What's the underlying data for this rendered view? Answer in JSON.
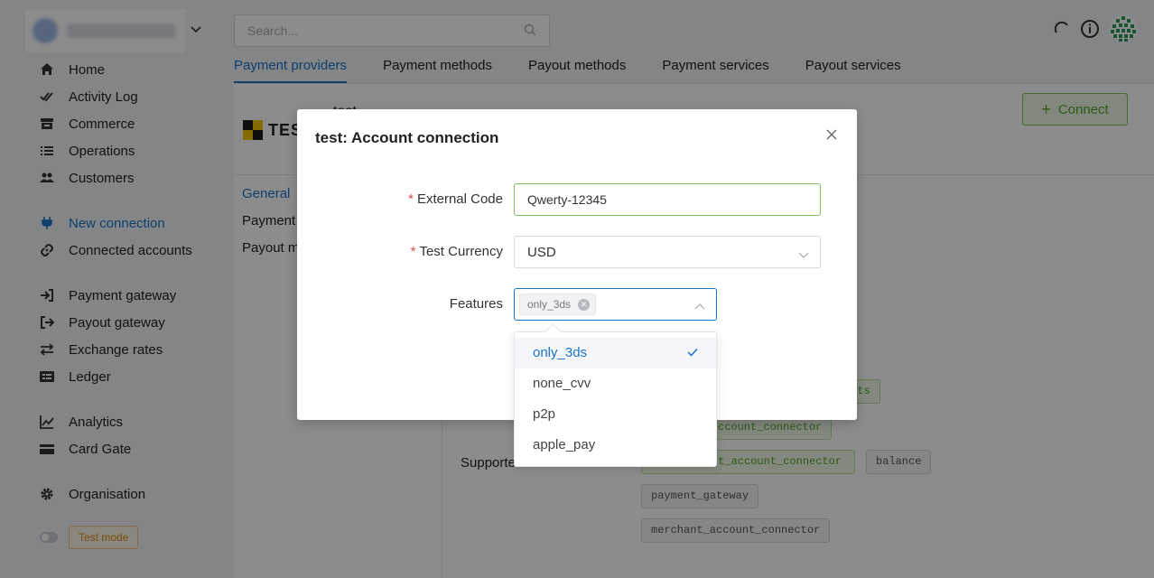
{
  "sidebar": {
    "nav": [
      {
        "label": "Home",
        "icon": "home-icon"
      },
      {
        "label": "Activity Log",
        "icon": "double-check-icon"
      },
      {
        "label": "Commerce",
        "icon": "store-icon"
      },
      {
        "label": "Operations",
        "icon": "list-icon"
      },
      {
        "label": "Customers",
        "icon": "users-icon"
      },
      {
        "label": "New connection",
        "icon": "plug-icon",
        "active": true
      },
      {
        "label": "Connected accounts",
        "icon": "link-icon"
      },
      {
        "label": "Payment gateway",
        "icon": "sign-in-icon"
      },
      {
        "label": "Payout gateway",
        "icon": "sign-out-icon"
      },
      {
        "label": "Exchange rates",
        "icon": "exchange-icon"
      },
      {
        "label": "Ledger",
        "icon": "ledger-icon"
      },
      {
        "label": "Analytics",
        "icon": "chart-icon"
      },
      {
        "label": "Card Gate",
        "icon": "card-icon"
      },
      {
        "label": "Organisation",
        "icon": "gear-icon"
      }
    ],
    "test_mode": "Test mode"
  },
  "search": {
    "placeholder": "Search..."
  },
  "tabs": [
    "Payment providers",
    "Payment methods",
    "Payout methods",
    "Payment services",
    "Payout services"
  ],
  "provider": {
    "brand": "TES",
    "name": "test",
    "connect_label": "Connect"
  },
  "side_menu": [
    "General",
    "Payment",
    "Payout m"
  ],
  "supported_label": "Supporte",
  "tags": [
    "ents",
    "ccount_connector",
    "nt_account_connector",
    "balance",
    "payment_gateway",
    "merchant_account_connector"
  ],
  "modal": {
    "title": "test: Account connection",
    "fields": {
      "external_code": {
        "label": "External Code",
        "value": "Qwerty-12345"
      },
      "test_currency": {
        "label": "Test Currency",
        "value": "USD"
      },
      "features": {
        "label": "Features",
        "chips": [
          "only_3ds"
        ]
      }
    }
  },
  "dropdown": {
    "options": [
      {
        "label": "only_3ds",
        "selected": true
      },
      {
        "label": "none_cvv",
        "selected": false
      },
      {
        "label": "p2p",
        "selected": false
      },
      {
        "label": "apple_pay",
        "selected": false
      }
    ]
  },
  "colors": {
    "accent": "#1a73c8",
    "success": "#52a32a",
    "required": "#e04a4a",
    "warning": "#d98a1a"
  }
}
